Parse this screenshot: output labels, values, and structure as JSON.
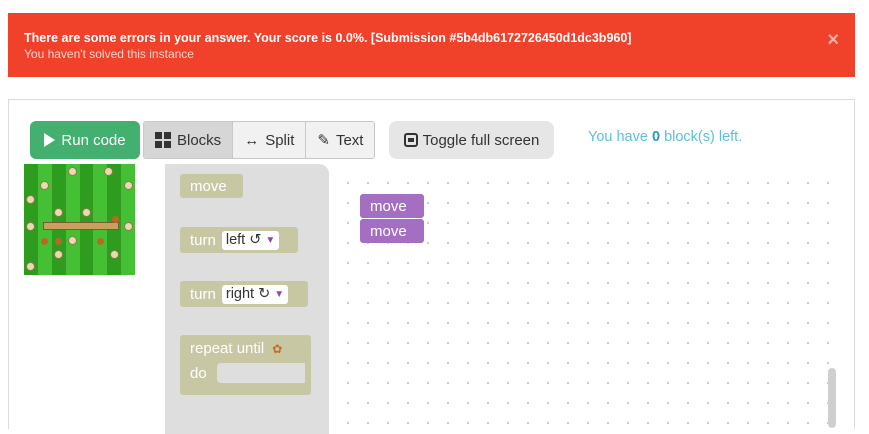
{
  "alert": {
    "title": "There are some errors in your answer. Your score is 0.0%. [Submission #5b4db6172726450d1dc3b960]",
    "subtitle": "You haven't solved this instance",
    "close": "×",
    "color": "#f0412a"
  },
  "toolbar": {
    "run_label": "Run code",
    "blocks_label": "Blocks",
    "split_label": "Split",
    "text_label": "Text",
    "toggle_label": "Toggle full screen",
    "active_mode": "Blocks"
  },
  "blocks_left": {
    "prefix": "You have ",
    "count": "0",
    "suffix": " block(s) left."
  },
  "toolbox": {
    "move": "move",
    "turn_left_label": "turn",
    "turn_left_value": "left ↺",
    "turn_right_label": "turn",
    "turn_right_value": "right ↻",
    "repeat_label": "repeat until",
    "do_label": "do",
    "block_color": "#c8c7a3"
  },
  "workspace": {
    "blocks": [
      "move",
      "move"
    ],
    "block_color": "#a46ec2"
  }
}
